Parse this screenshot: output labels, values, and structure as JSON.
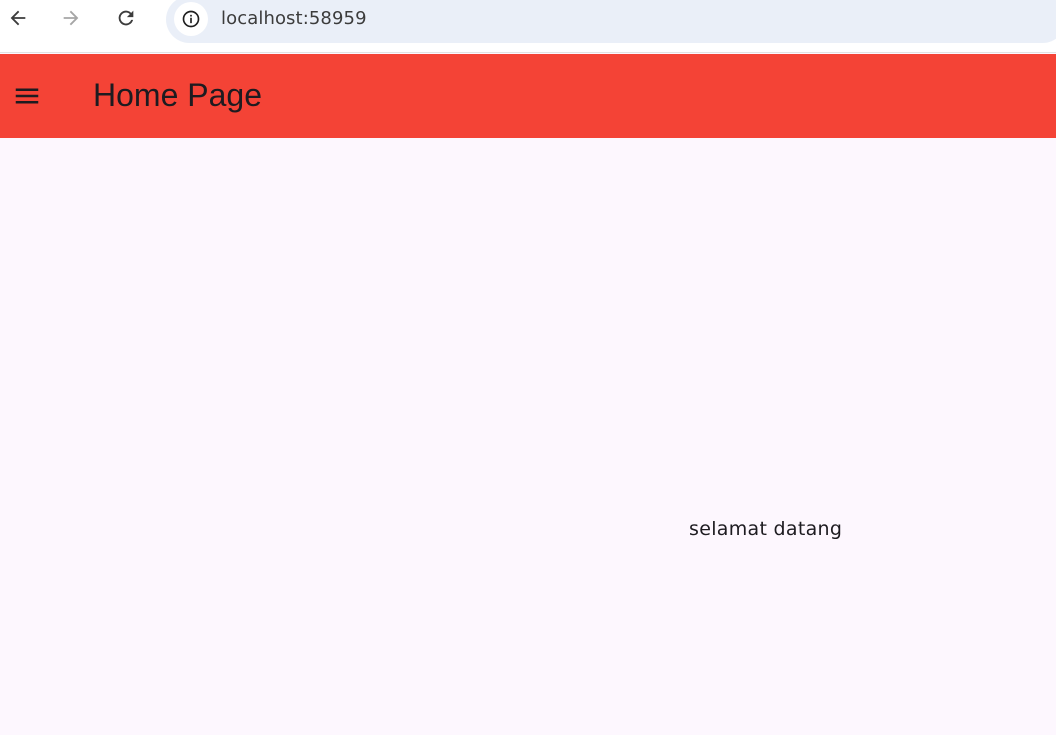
{
  "browser": {
    "url": "localhost:58959",
    "icons": {
      "back": "arrow-left-icon",
      "forward": "arrow-right-icon",
      "reload": "reload-icon",
      "site_info": "info-icon"
    }
  },
  "app_bar": {
    "title": "Home Page",
    "color": "#f44336",
    "menu_icon": "hamburger-menu-icon"
  },
  "body": {
    "welcome_text": "selamat datang",
    "background": "#fdf7fe"
  }
}
